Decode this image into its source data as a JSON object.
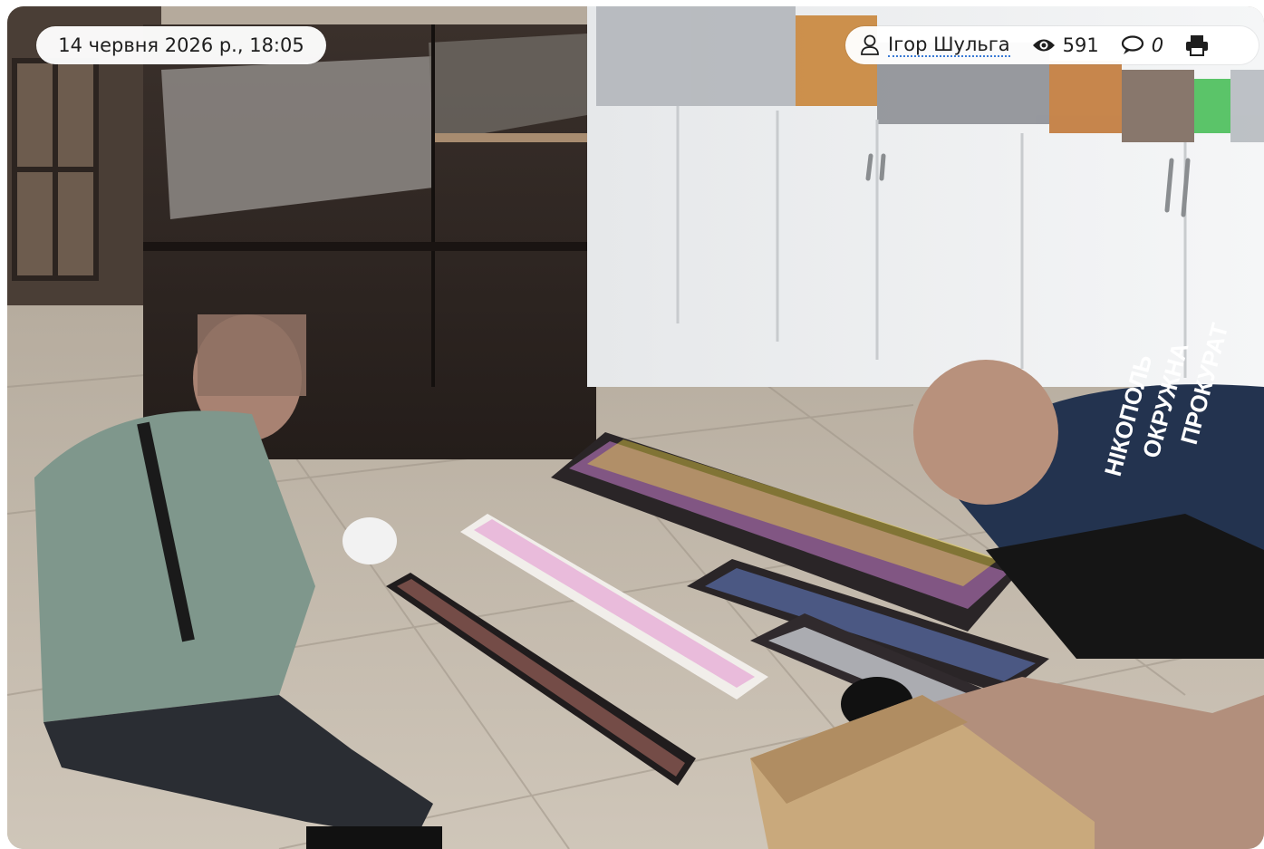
{
  "post": {
    "date": "14 червня 2026 р., 18:05",
    "author": "Ігор Шульга",
    "views": "591",
    "comments": "0"
  },
  "icons": {
    "author": "user-icon",
    "views": "eye-icon",
    "comments": "comment-icon",
    "print": "print-icon"
  },
  "photo": {
    "vest_text": [
      "НІКОПОЛЬ",
      "ОКРУЖНА",
      "ПРОКУРАТ"
    ]
  },
  "colors": {
    "link_underline": "#3a7bd5",
    "pill_bg": "#ffffff",
    "text": "#1e1e1e"
  }
}
